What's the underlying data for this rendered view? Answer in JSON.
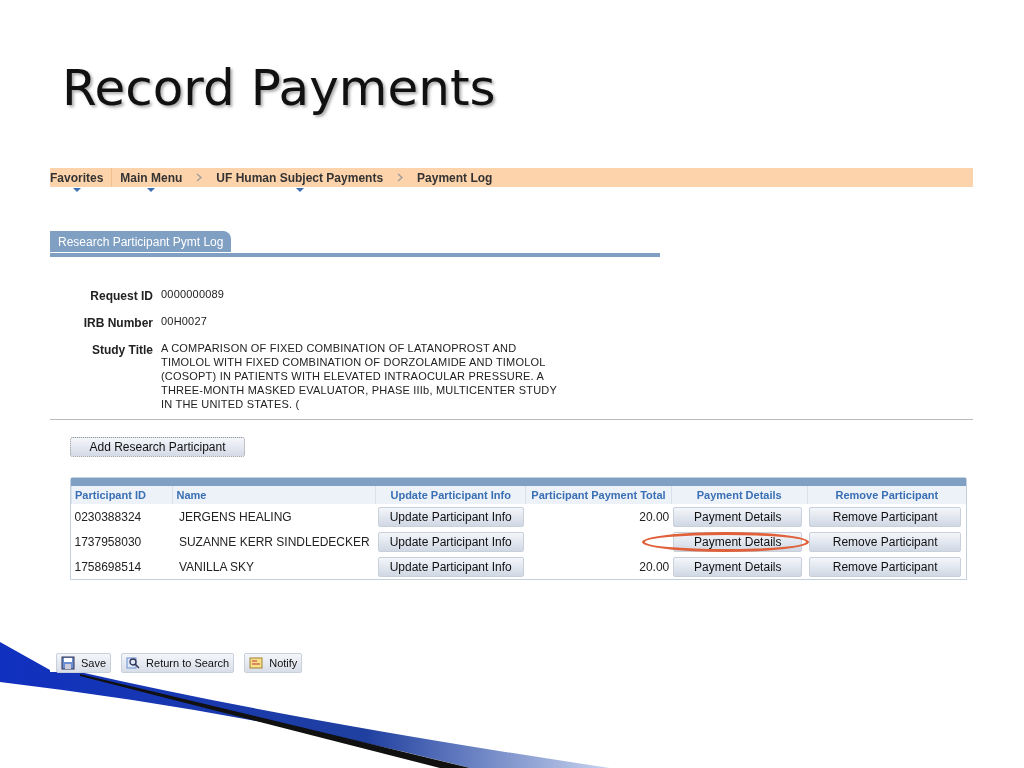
{
  "slide_title": "Record Payments",
  "breadcrumb": [
    {
      "label": "Favorites",
      "dropdown": true
    },
    {
      "label": "Main Menu",
      "dropdown": true
    },
    {
      "label": "UF Human Subject Payments",
      "dropdown": true
    },
    {
      "label": "Payment Log",
      "dropdown": false
    }
  ],
  "tab": {
    "label": "Research Participant Pymt Log"
  },
  "fields": [
    {
      "label": "Request ID",
      "value": "0000000089"
    },
    {
      "label": "IRB Number",
      "value": "00H0027"
    },
    {
      "label": "Study Title",
      "value": "A COMPARISON OF FIXED COMBINATION OF LATANOPROST AND TIMOLOL WITH FIXED COMBINATION OF DORZOLAMIDE AND TIMOLOL (COSOPT) IN PATIENTS WITH ELEVATED INTRAOCULAR PRESSURE. A THREE-MONTH MASKED EVALUATOR, PHASE IIIb, MULTICENTER STUDY IN THE UNITED STATES.  ("
    }
  ],
  "add_button": "Add Research Participant",
  "table": {
    "columns": [
      "Participant ID",
      "Name",
      "Update Participant Info",
      "Participant Payment Total",
      "Payment Details",
      "Remove Participant"
    ],
    "rows": [
      {
        "id": "0230388324",
        "name": "JERGENS  HEALING",
        "update": "Update Participant Info",
        "total": "20.00",
        "details": "Payment Details",
        "remove": "Remove Participant",
        "highlighted": false
      },
      {
        "id": "1737958030",
        "name": "SUZANNE KERR SINDLEDECKER",
        "update": "Update Participant Info",
        "details": "Payment Details",
        "remove": "Remove Participant",
        "highlighted": true
      },
      {
        "id": "1758698514",
        "name": "VANILLA  SKY",
        "update": "Update Participant Info",
        "total": "20.00",
        "details": "Payment Details",
        "remove": "Remove Participant",
        "highlighted": false
      }
    ]
  },
  "toolbar": [
    {
      "kind": "save",
      "label": "Save"
    },
    {
      "kind": "search",
      "label": "Return to Search"
    },
    {
      "kind": "notify",
      "label": "Notify"
    }
  ]
}
